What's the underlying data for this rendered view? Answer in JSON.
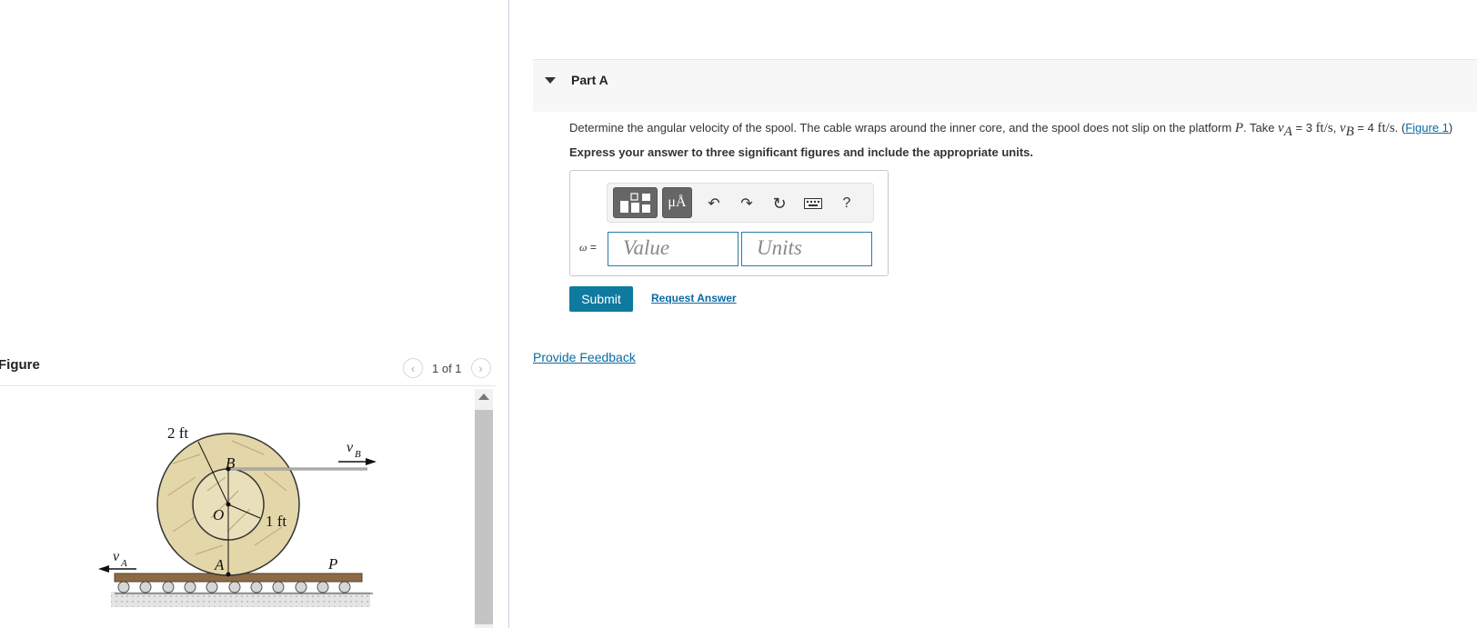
{
  "figure_panel": {
    "title": "Figure",
    "pager": "1 of 1",
    "prev_icon": "chevron-left-icon",
    "next_icon": "chevron-right-icon",
    "labels": {
      "outer_radius": "2 ft",
      "inner_radius": "1 ft",
      "point_b": "B",
      "point_o": "O",
      "point_a": "A",
      "platform": "P",
      "va_main": "v",
      "va_sub": "A",
      "vb_main": "v",
      "vb_sub": "B"
    }
  },
  "part": {
    "title": "Part A",
    "question": {
      "prefix": "Determine the angular velocity of the spool. The cable wraps around the inner core, and the spool does not slip on the platform ",
      "platform_symbol": "P",
      "take": ". Take ",
      "va_symbol": "v",
      "va_sub": "A",
      "va_value": " = 3 ",
      "va_units": "ft/s",
      "sep": ", ",
      "vb_symbol": "v",
      "vb_sub": "B",
      "vb_value": " = 4 ",
      "vb_units": "ft/s",
      "end": ". (",
      "figure_link": "Figure 1",
      "close": ")"
    },
    "instruction": "Express your answer to three significant figures and include the appropriate units.",
    "toolbar": {
      "units_button_label": "μÅ",
      "help_label": "?",
      "icons": [
        "templates-icon",
        "units-icon",
        "undo-icon",
        "redo-icon",
        "reset-icon",
        "keyboard-icon",
        "help-icon"
      ]
    },
    "answer": {
      "variable": "ω",
      "equals": " =",
      "value_placeholder": "Value",
      "units_placeholder": "Units"
    },
    "submit_label": "Submit",
    "request_answer_label": "Request Answer"
  },
  "feedback_label": "Provide Feedback",
  "colors": {
    "accent": "#0e7aa0",
    "link": "#0a6aa3",
    "spool": "#e3d6a8",
    "platform": "#8b6a45"
  }
}
